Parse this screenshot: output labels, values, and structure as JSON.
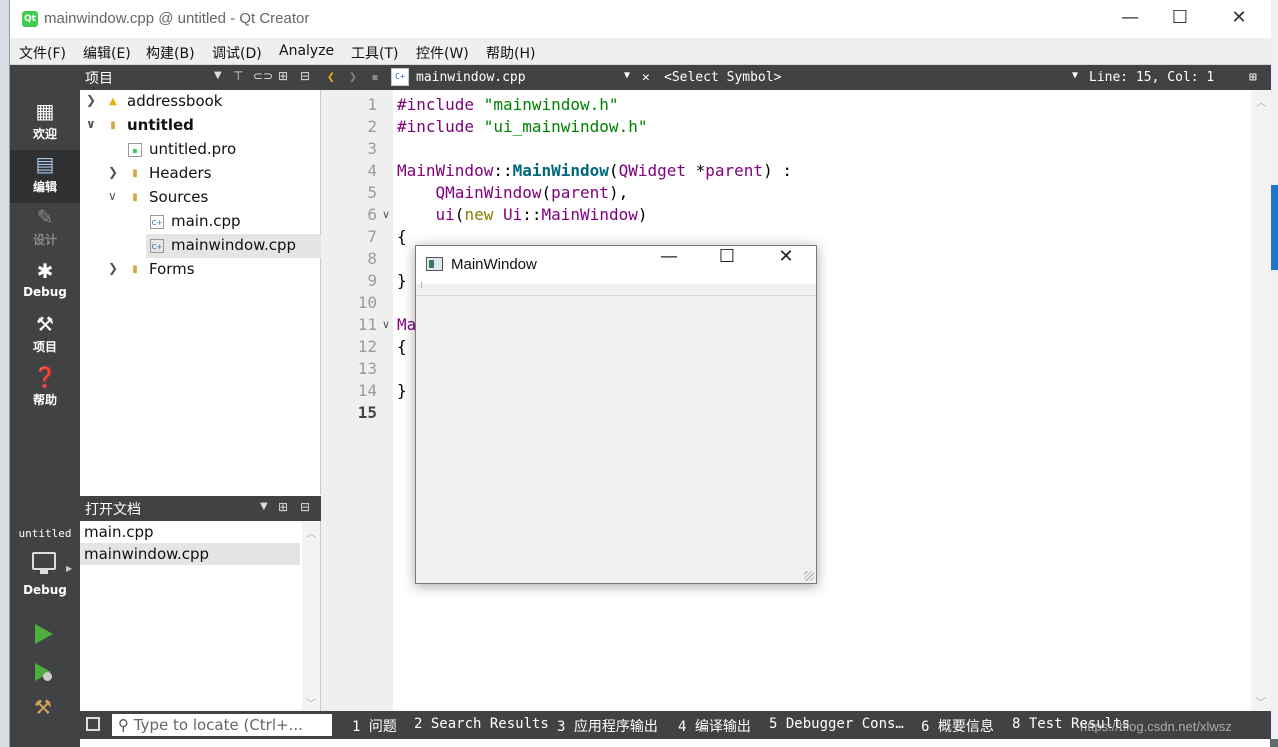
{
  "window": {
    "title": "mainwindow.cpp @ untitled - Qt Creator",
    "app_icon": "Qt",
    "minimize": "—",
    "maximize": "☐",
    "close": "✕"
  },
  "menu": [
    "文件(F)",
    "编辑(E)",
    "构建(B)",
    "调试(D)",
    "Analyze",
    "工具(T)",
    "控件(W)",
    "帮助(H)"
  ],
  "modes": [
    {
      "label": "欢迎",
      "icon": "grid-icon"
    },
    {
      "label": "编辑",
      "icon": "document-icon"
    },
    {
      "label": "设计",
      "icon": "pencil-icon"
    },
    {
      "label": "Debug",
      "icon": "bug-icon"
    },
    {
      "label": "项目",
      "icon": "wrench-icon"
    },
    {
      "label": "帮助",
      "icon": "help-icon"
    }
  ],
  "kit": {
    "project": "untitled",
    "config": "Debug"
  },
  "project_panel": {
    "header": "项目",
    "tree": [
      {
        "label": "addressbook",
        "icon": "warning-icon",
        "level": 0,
        "expanded": false
      },
      {
        "label": "untitled",
        "icon": "project-icon",
        "level": 0,
        "expanded": true
      },
      {
        "label": "untitled.pro",
        "icon": "pro-file-icon",
        "level": 1
      },
      {
        "label": "Headers",
        "icon": "headers-folder-icon",
        "level": 1,
        "expanded": false
      },
      {
        "label": "Sources",
        "icon": "sources-folder-icon",
        "level": 1,
        "expanded": true
      },
      {
        "label": "main.cpp",
        "icon": "cpp-file-icon",
        "level": 2
      },
      {
        "label": "mainwindow.cpp",
        "icon": "cpp-file-icon",
        "level": 2,
        "selected": true
      },
      {
        "label": "Forms",
        "icon": "forms-folder-icon",
        "level": 1,
        "expanded": false
      }
    ]
  },
  "open_docs": {
    "header": "打开文档",
    "items": [
      "main.cpp",
      "mainwindow.cpp"
    ],
    "selected": "mainwindow.cpp"
  },
  "editor_toolbar": {
    "file": "mainwindow.cpp",
    "symbol": "<Select Symbol>",
    "position": "Line: 15, Col: 1"
  },
  "editor": {
    "line_numbers": [
      "1",
      "2",
      "3",
      "4",
      "5",
      "6",
      "7",
      "8",
      "9",
      "10",
      "11",
      "12",
      "13",
      "14",
      "15"
    ],
    "current_line": "15"
  },
  "status": {
    "locator_placeholder": "Type to locate (Ctrl+...",
    "tabs": [
      "1 问题",
      "2 Search Results",
      "3 应用程序输出",
      "4 编译输出",
      "5 Debugger Cons…",
      "6 概要信息",
      "8 Test Results"
    ],
    "watermark": "https://blog.csdn.net/xlwsz"
  },
  "app_window": {
    "title": "MainWindow",
    "minimize": "—",
    "maximize": "☐",
    "close": "✕"
  },
  "colors": {
    "accent": "#41cd52",
    "sidebar": "#404244"
  }
}
